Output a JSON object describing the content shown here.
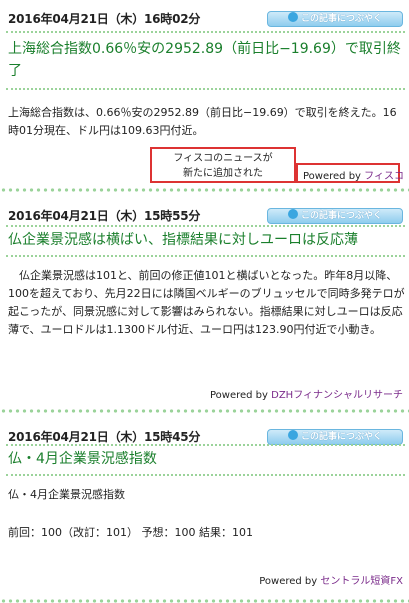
{
  "tweet_button_label": "この記事につぶやく",
  "articles": [
    {
      "date": "2016年04月21日（木）16時02分",
      "title": "上海総合指数0.66％安の2952.89（前日比−19.69）で取引終了",
      "body": "上海総合指数は、0.66％安の2952.89（前日比−19.69）で取引を終えた。16時01分現在、ドル円は109.63円付近。",
      "powered_prefix": "Powered by",
      "powered_source": "フィスコ"
    },
    {
      "date": "2016年04月21日（木）15時55分",
      "title": "仏企業景況感は横ばい、指標結果に対しユーロは反応薄",
      "body": "仏企業景況感は101と、前回の修正値101と横ばいとなった。昨年8月以降、100を超えており、先月22日には隣国ベルギーのブリュッセルで同時多発テロが起こったが、同景況感に対して影響はみられない。指標結果に対しユーロは反応薄で、ユーロドルは1.1300ドル付近、ユーロ円は123.90円付近で小動き。",
      "powered_prefix": "Powered by",
      "powered_source": "DZHフィナンシャルリサーチ"
    },
    {
      "date": "2016年04月21日（木）15時45分",
      "title": "仏・4月企業景況感指数",
      "body_line1": "仏・4月企業景況感指数",
      "body_line2": "前回：100（改訂：101） 予想：100 結果：101",
      "powered_prefix": "Powered by",
      "powered_source": "セントラル短資FX"
    }
  ],
  "popup": {
    "line1": "フィスコのニュースが",
    "line2": "新たに追加された"
  }
}
